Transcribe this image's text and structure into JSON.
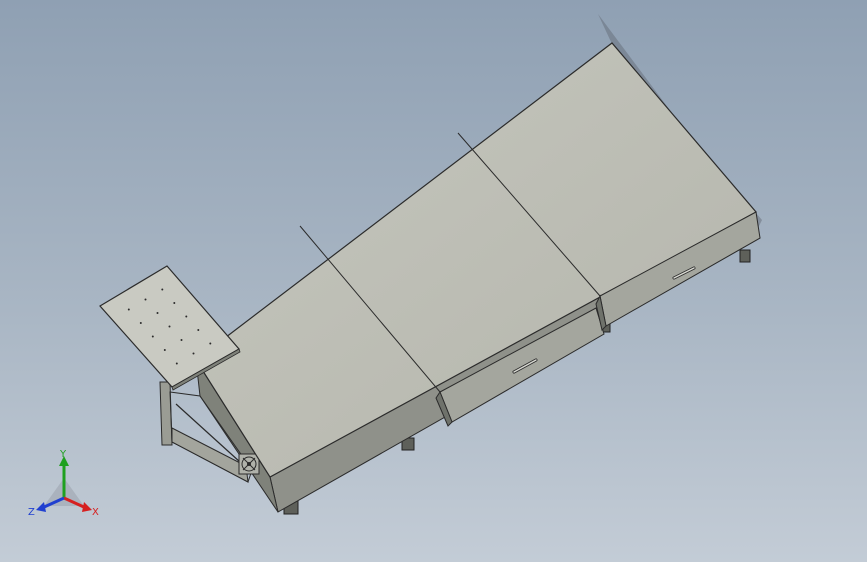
{
  "viewport": {
    "background_top": "#8fa0b3",
    "background_bottom": "#c3ccd6"
  },
  "model": {
    "top_color": "#bfc0b7",
    "side_color": "#8f918a",
    "edge_color": "#2b2b2b",
    "panel_count": 3,
    "drawer_count": 2,
    "vent_icon": "fan-icon"
  },
  "triad": {
    "x_label": "X",
    "y_label": "Y",
    "z_label": "Z",
    "x_color": "#d62020",
    "y_color": "#1fa01f",
    "z_color": "#2040d0"
  }
}
